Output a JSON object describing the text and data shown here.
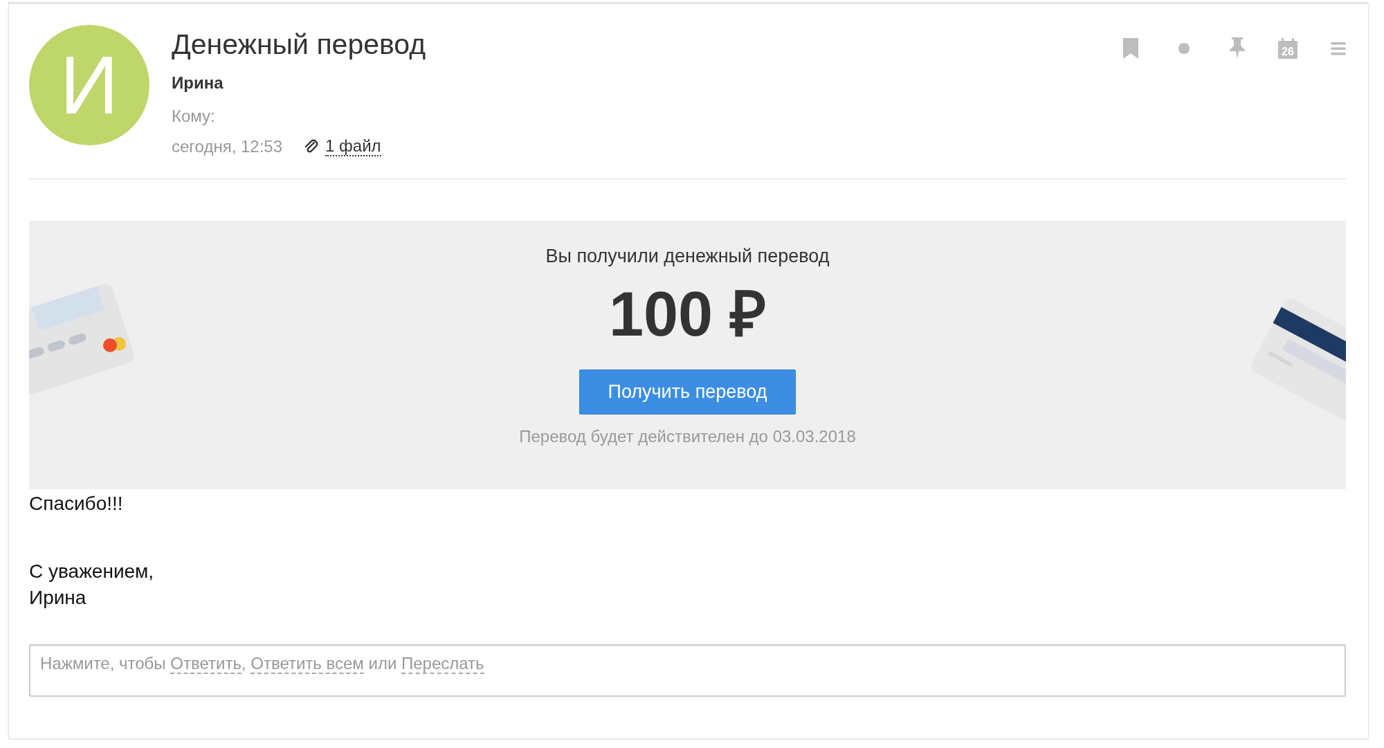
{
  "message": {
    "avatar_letter": "И",
    "subject": "Денежный перевод",
    "sender": "Ирина",
    "to_label": "Кому:",
    "date": "сегодня, 12:53",
    "attachments": "1 файл"
  },
  "toolbar": {
    "calendar_day": "26"
  },
  "transfer": {
    "heading": "Вы получили денежный перевод",
    "amount": "100 ₽",
    "button": "Получить перевод",
    "validity": "Перевод будет действителен до 03.03.2018"
  },
  "body": [
    "Спасибо!!!",
    "С уважением,\nИрина"
  ],
  "reply": [
    {
      "kind": "text",
      "text": "Нажмите, чтобы"
    },
    {
      "kind": "link",
      "text": "Ответить"
    },
    {
      "kind": "text",
      "text": ","
    },
    {
      "kind": "link",
      "text": "Ответить всем"
    },
    {
      "kind": "text",
      "text": "или"
    },
    {
      "kind": "link",
      "text": "Переслать"
    }
  ]
}
